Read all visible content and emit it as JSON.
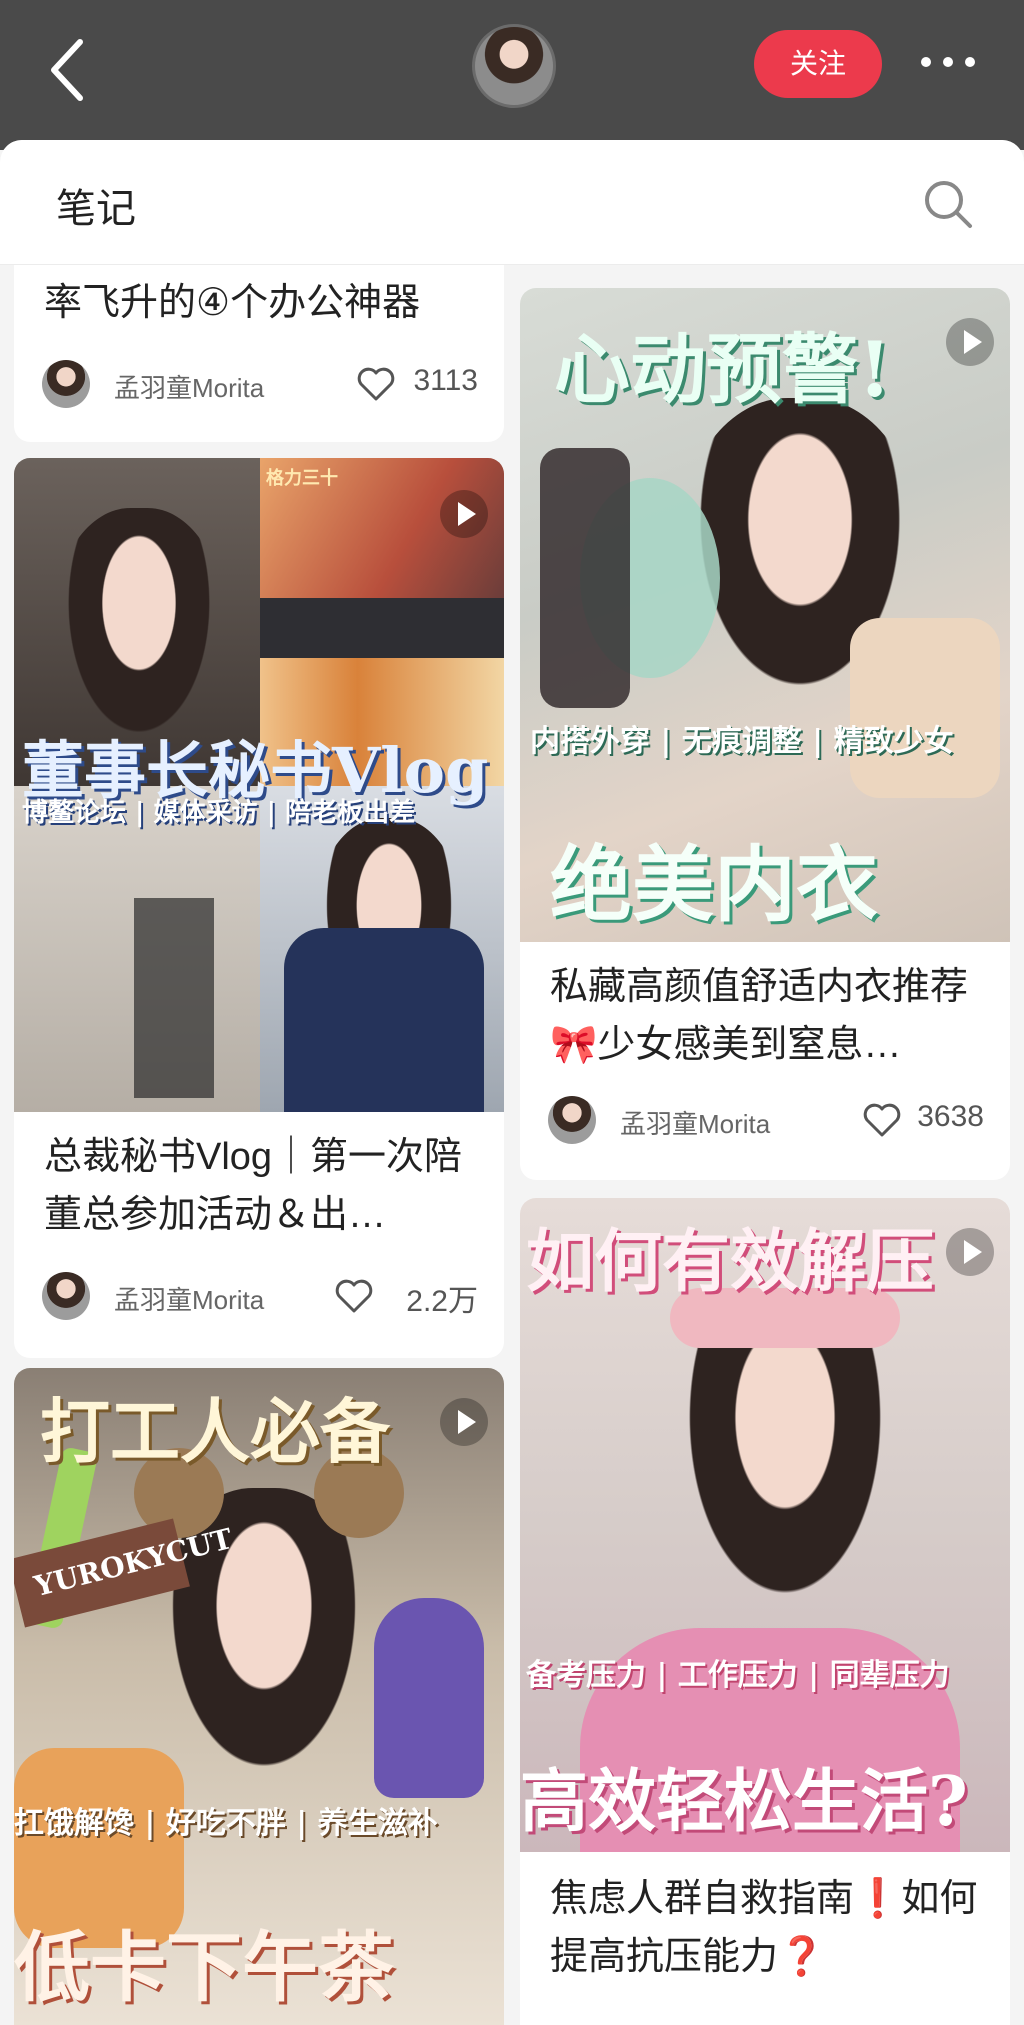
{
  "header": {
    "follow_label": "关注"
  },
  "sheet": {
    "title": "笔记"
  },
  "cards": {
    "c1": {
      "title_partial": "率飞升的④个办公神器",
      "author": "孟羽童Morita",
      "likes": "3113"
    },
    "c2": {
      "cover_heading": "董事长秘书Vlog",
      "cover_tags": "博鳌论坛 | 媒体采访 | 陪老板出差",
      "cover_screen_text": "格力三十",
      "title": "总裁秘书Vlog｜第一次陪董总参加活动＆出…",
      "author": "孟羽童Morita",
      "likes": "2.2万"
    },
    "c3": {
      "cover_heading": "打工人必备",
      "cover_tags": "扛饿解馋 | 好吃不胖 | 养生滋补",
      "cover_bottom": "低卡下午茶",
      "cover_product": "YUROKYCUT"
    },
    "c4": {
      "cover_heading": "心动预警!",
      "cover_tags": "内搭外穿 | 无痕调整 | 精致少女",
      "cover_bottom": "绝美内衣",
      "title": "私藏高颜值舒适内衣推荐🎀少女感美到窒息…",
      "author": "孟羽童Morita",
      "likes": "3638"
    },
    "c5": {
      "cover_heading": "如何有效解压",
      "cover_tags": "备考压力 | 工作压力 | 同辈压力",
      "cover_bottom": "高效轻松生活?",
      "title": "焦虑人群自救指南❗如何提高抗压能力❓"
    }
  },
  "colors": {
    "accent": "#ec3a4c",
    "topbar": "#4a4a4a"
  },
  "icons": [
    "back-arrow-icon",
    "more-icon",
    "search-icon",
    "heart-icon",
    "play-icon"
  ]
}
